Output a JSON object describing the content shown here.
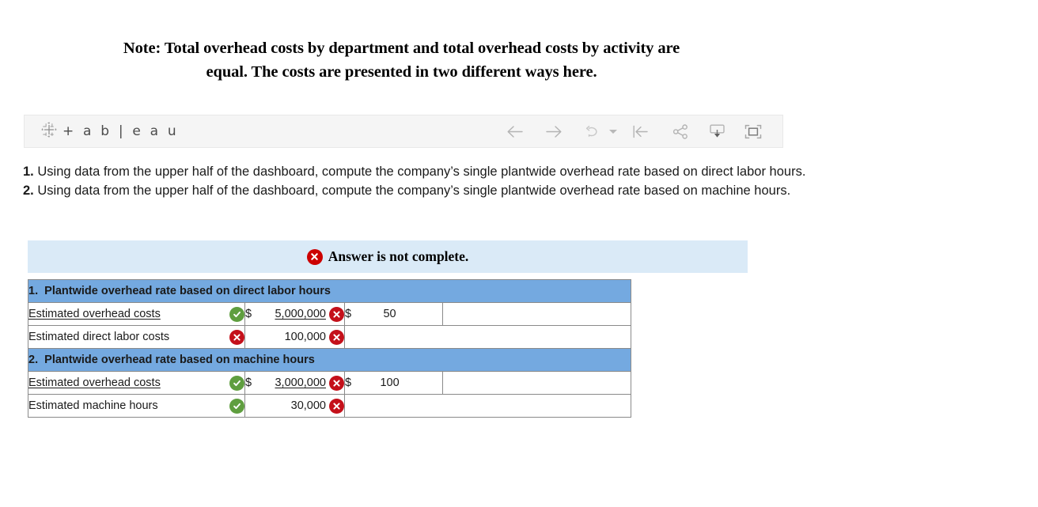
{
  "note": {
    "line1": "Note: Total overhead costs by department and total overhead costs by activity are",
    "line2": "equal. The costs are presented in two different ways here."
  },
  "toolbar": {
    "wordmark": "+ a b | e a u",
    "logo_icon": "tableau-logo-icon",
    "buttons": [
      {
        "name": "back-button",
        "icon": "arrow-left-icon",
        "label": "Back"
      },
      {
        "name": "forward-button",
        "icon": "arrow-right-icon",
        "label": "Forward"
      },
      {
        "name": "revert-button",
        "icon": "revert-arrow-icon",
        "label": "Revert"
      },
      {
        "name": "revert-dropdown",
        "icon": "chevron-down-icon",
        "label": "Revert options"
      },
      {
        "name": "reset-button",
        "icon": "reset-to-start-icon",
        "label": "Reset"
      },
      {
        "name": "share-button",
        "icon": "share-icon",
        "label": "Share"
      },
      {
        "name": "download-button",
        "icon": "download-icon",
        "label": "Download"
      },
      {
        "name": "fullscreen-button",
        "icon": "fullscreen-icon",
        "label": "Full Screen"
      }
    ]
  },
  "questions": {
    "q1_num": "1.",
    "q1_text": "Using data from the upper half of the dashboard, compute the company’s single plantwide overhead rate based on direct labor hours.",
    "q2_num": "2.",
    "q2_text": "Using data from the upper half of the dashboard, compute the company’s single plantwide overhead rate based on machine hours."
  },
  "banner": {
    "icon": "error-x-icon",
    "text": "Answer is not complete."
  },
  "table": {
    "sections": [
      {
        "heading_num": "1.",
        "heading_text": "Plantwide overhead rate based on direct labor hours",
        "rows": [
          {
            "label": "Estimated overhead costs",
            "label_underlined": true,
            "label_status": "correct",
            "value_currency": "$",
            "value": "5,000,000",
            "value_underlined": true,
            "value_status": "incorrect",
            "rate_currency": "$",
            "rate": "50",
            "has_rate": true
          },
          {
            "label": "Estimated direct labor costs",
            "label_underlined": false,
            "label_status": "incorrect",
            "value_currency": "",
            "value": "100,000",
            "value_underlined": false,
            "value_status": "incorrect",
            "rate_currency": "",
            "rate": "",
            "has_rate": false
          }
        ]
      },
      {
        "heading_num": "2.",
        "heading_text": "Plantwide overhead rate based on machine hours",
        "rows": [
          {
            "label": "Estimated overhead costs",
            "label_underlined": true,
            "label_status": "correct",
            "value_currency": "$",
            "value": "3,000,000",
            "value_underlined": true,
            "value_status": "incorrect",
            "rate_currency": "$",
            "rate": "100",
            "has_rate": true
          },
          {
            "label": "Estimated machine hours",
            "label_underlined": false,
            "label_status": "correct",
            "value_currency": "",
            "value": "30,000",
            "value_underlined": false,
            "value_status": "incorrect",
            "rate_currency": "",
            "rate": "",
            "has_rate": false
          }
        ]
      }
    ]
  },
  "colors": {
    "section_header_blue": "#74a9e0",
    "banner_blue": "#daeaf7",
    "correct_green": "#5f9e3f",
    "incorrect_red": "#c4101a",
    "banner_red": "#cc0000",
    "value_cell_pink": "#fdf2f2",
    "toolbar_gray": "#f5f5f5"
  }
}
